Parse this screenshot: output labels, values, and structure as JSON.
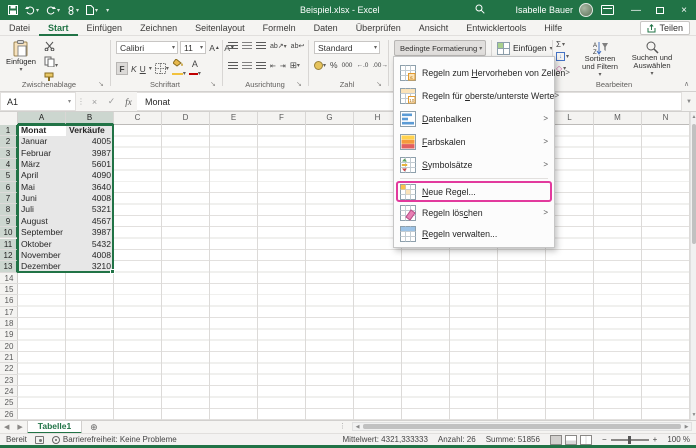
{
  "titlebar": {
    "title": "Beispiel.xlsx - Excel",
    "user": "Isabelle Bauer",
    "minimize": "—",
    "maximize": "",
    "close": "×"
  },
  "tabs": {
    "items": [
      "Datei",
      "Start",
      "Einfügen",
      "Zeichnen",
      "Seitenlayout",
      "Formeln",
      "Daten",
      "Überprüfen",
      "Ansicht",
      "Entwicklertools",
      "Hilfe"
    ],
    "active": "Start",
    "share_label": "Teilen"
  },
  "ribbon": {
    "clipboard": {
      "paste_label": "Einfügen",
      "group_label": "Zwischenablage"
    },
    "font": {
      "name": "Calibri",
      "size": "11",
      "bold": "F",
      "italic": "K",
      "underline": "U",
      "grow": "A",
      "shrink": "A",
      "group_label": "Schriftart"
    },
    "alignment": {
      "group_label": "Ausrichtung"
    },
    "number": {
      "format": "Standard",
      "percent": "%",
      "thousands": "000",
      "group_label": "Zahl"
    },
    "styles": {
      "conditional_formatting_label": "Bedingte Formatierung"
    },
    "cells": {
      "insert_label": "Einfügen"
    },
    "editing": {
      "autosum": "Σ",
      "sort_label": "Sortieren und Filtern",
      "find_label": "Suchen und Auswählen",
      "group_label": "Bearbeiten"
    }
  },
  "formula_bar": {
    "name_box": "A1",
    "value": "Monat"
  },
  "menu": {
    "items": [
      {
        "label": "Regeln zum Hervorheben von Zellen",
        "accel": "H",
        "arrow": true,
        "icon": "highlight-cells-rules-icon",
        "big": true,
        "highlighted": false,
        "sep_before": false
      },
      {
        "label": "Regeln für oberste/unterste Werte",
        "accel": "o",
        "arrow": true,
        "icon": "top-bottom-rules-icon",
        "big": true,
        "highlighted": false,
        "sep_before": false
      },
      {
        "label": "Datenbalken",
        "accel": "D",
        "arrow": true,
        "icon": "data-bars-icon",
        "big": true,
        "highlighted": false,
        "sep_before": false
      },
      {
        "label": "Farbskalen",
        "accel": "F",
        "arrow": true,
        "icon": "color-scales-icon",
        "big": true,
        "highlighted": false,
        "sep_before": false
      },
      {
        "label": "Symbolsätze",
        "accel": "S",
        "arrow": true,
        "icon": "icon-sets-icon",
        "big": true,
        "highlighted": false,
        "sep_before": false
      },
      {
        "label": "Neue Regel...",
        "accel": "N",
        "arrow": false,
        "icon": "new-rule-icon",
        "big": false,
        "highlighted": true,
        "sep_before": true
      },
      {
        "label": "Regeln löschen",
        "accel": "c",
        "arrow": true,
        "icon": "clear-rules-icon",
        "big": false,
        "highlighted": false,
        "sep_before": false
      },
      {
        "label": "Regeln verwalten...",
        "accel": "R",
        "arrow": false,
        "icon": "manage-rules-icon",
        "big": false,
        "highlighted": false,
        "sep_before": false
      }
    ]
  },
  "grid": {
    "columns": [
      "A",
      "B",
      "C",
      "D",
      "E",
      "F",
      "G",
      "H",
      "I",
      "J",
      "K",
      "L",
      "M",
      "N"
    ],
    "selected_columns": [
      "A",
      "B"
    ],
    "row_count": 27,
    "selected_rows": 13,
    "header": [
      "Monat",
      "Verkäufe"
    ],
    "data": [
      [
        "Januar",
        "4005"
      ],
      [
        "Februar",
        "3987"
      ],
      [
        "März",
        "5601"
      ],
      [
        "April",
        "4090"
      ],
      [
        "Mai",
        "3640"
      ],
      [
        "Juni",
        "4008"
      ],
      [
        "Juli",
        "5321"
      ],
      [
        "August",
        "4567"
      ],
      [
        "September",
        "3987"
      ],
      [
        "Oktober",
        "5432"
      ],
      [
        "November",
        "4008"
      ],
      [
        "Dezember",
        "3210"
      ]
    ],
    "selection": {
      "range": "A1:B13",
      "active_cell": "A1"
    }
  },
  "sheet_bar": {
    "active_tab": "Tabelle1"
  },
  "status_bar": {
    "mode": "Bereit",
    "accessibility": "Barrierefreiheit: Keine Probleme",
    "average": "Mittelwert: 4321,333333",
    "count": "Anzahl: 26",
    "sum": "Summe: 51856",
    "zoom": "100 %"
  },
  "colors": {
    "excel_green": "#217346",
    "annotation_pink": "#e23a9d",
    "selection_fill": "#e7e7e7"
  }
}
